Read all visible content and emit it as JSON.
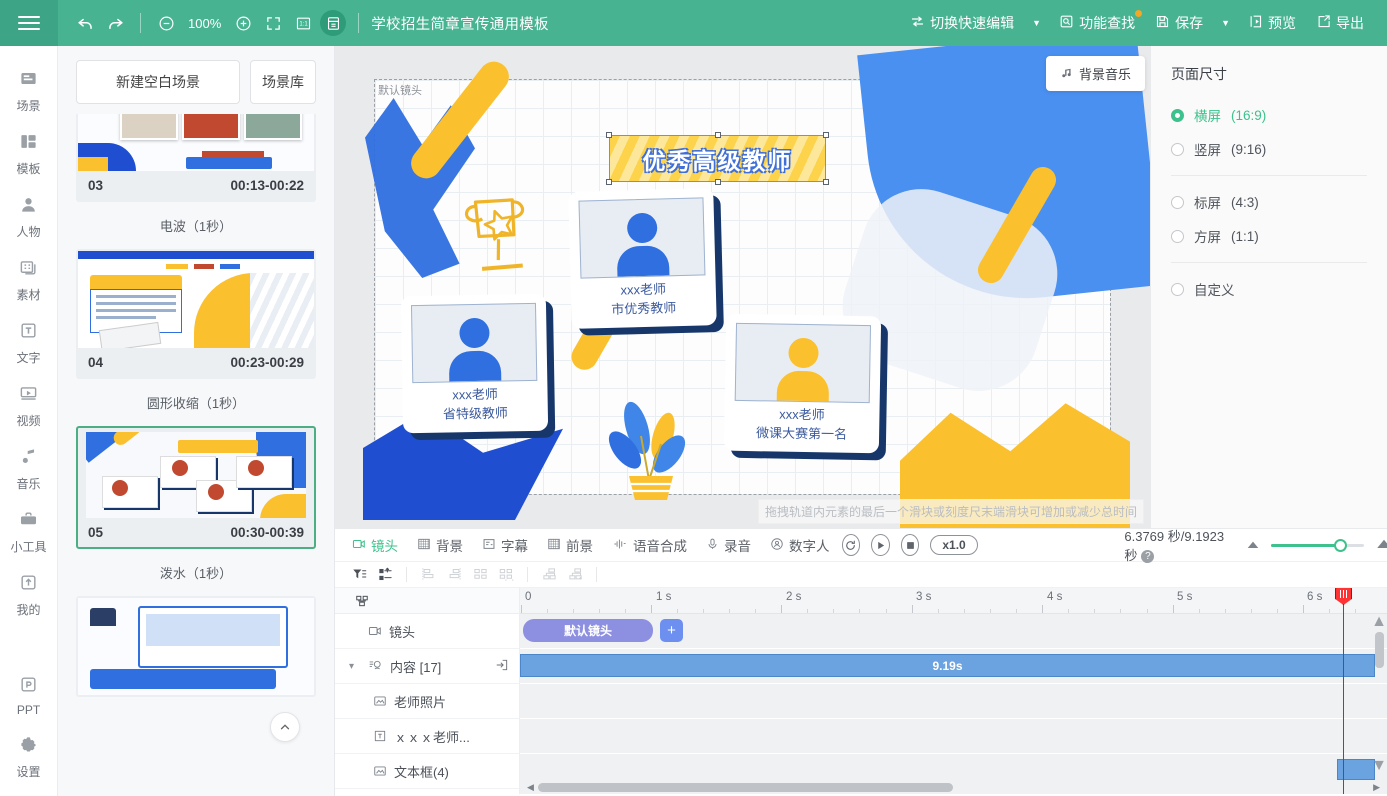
{
  "topbar": {
    "menu_icon": "hamburger-icon",
    "undo_icon": "undo-icon",
    "redo_icon": "redo-icon",
    "zoom_out_icon": "zoom-out-icon",
    "zoom_level": "100%",
    "zoom_in_icon": "zoom-in-icon",
    "fullscreen_icon": "fit-screen-icon",
    "actual_size_icon": "actual-size-icon",
    "safe_area_icon": "safe-area-icon",
    "doc_title": "学校招生简章宣传通用模板",
    "quick_edit": "切换快速编辑",
    "feature_search": "功能查找",
    "save": "保存",
    "preview": "预览",
    "export": "导出"
  },
  "rail": {
    "items": [
      {
        "label": "场景",
        "icon": "scene-icon"
      },
      {
        "label": "模板",
        "icon": "template-icon"
      },
      {
        "label": "人物",
        "icon": "person-icon"
      },
      {
        "label": "素材",
        "icon": "material-icon"
      },
      {
        "label": "文字",
        "icon": "text-icon"
      },
      {
        "label": "视频",
        "icon": "video-icon"
      },
      {
        "label": "音乐",
        "icon": "music-icon"
      },
      {
        "label": "小工具",
        "icon": "toolbox-icon"
      },
      {
        "label": "我的",
        "icon": "my-upload-icon"
      }
    ],
    "bottom": [
      {
        "label": "PPT",
        "icon": "ppt-icon"
      },
      {
        "label": "设置",
        "icon": "settings-icon"
      }
    ]
  },
  "scenes": {
    "new_blank": "新建空白场景",
    "library": "场景库",
    "cards": [
      {
        "index": "03",
        "time": "00:13-00:22",
        "selected": false,
        "transition": "电波（1秒）"
      },
      {
        "index": "04",
        "time": "00:23-00:29",
        "selected": false,
        "transition": "圆形收缩（1秒）"
      },
      {
        "index": "05",
        "time": "00:30-00:39",
        "selected": true,
        "transition": "泼水（1秒）"
      }
    ]
  },
  "canvas": {
    "camera_label": "默认镜头",
    "bgm_button": "背景音乐",
    "bgm_icon": "music-note-icon",
    "hint": "拖拽轨道内元素的最后一个滑块或刻度尺末端滑块可增加或减少总时间",
    "title_text": "优秀高级教师",
    "cards": [
      {
        "name": "xxx老师",
        "role": "市优秀教师",
        "color": "blue"
      },
      {
        "name": "xxx老师",
        "role": "省特级教师",
        "color": "blue"
      },
      {
        "name": "xxx老师",
        "role": "微课大赛第一名",
        "color": "yellow"
      }
    ]
  },
  "rightpanel": {
    "title": "页面尺寸",
    "options": [
      {
        "label": "横屏",
        "ratio": "(16:9)",
        "selected": true
      },
      {
        "label": "竖屏",
        "ratio": "(9:16)",
        "selected": false
      },
      {
        "label": "标屏",
        "ratio": "(4:3)",
        "selected": false
      },
      {
        "label": "方屏",
        "ratio": "(1:1)",
        "selected": false
      },
      {
        "label": "自定义",
        "ratio": "",
        "selected": false
      }
    ]
  },
  "timeline": {
    "tabs": [
      {
        "label": "镜头",
        "icon": "camera-icon",
        "active": true
      },
      {
        "label": "背景",
        "icon": "background-icon",
        "active": false
      },
      {
        "label": "字幕",
        "icon": "subtitle-icon",
        "active": false
      },
      {
        "label": "前景",
        "icon": "foreground-icon",
        "active": false
      },
      {
        "label": "语音合成",
        "icon": "tts-icon",
        "active": false
      },
      {
        "label": "录音",
        "icon": "microphone-icon",
        "active": false
      },
      {
        "label": "数字人",
        "icon": "digital-human-icon",
        "active": false
      }
    ],
    "replay_icon": "replay-icon",
    "play_icon": "play-icon",
    "stop_icon": "stop-icon",
    "speed": "x1.0",
    "time_display": "6.3769 秒/9.1923 秒",
    "help_icon": "help-icon",
    "zoom_min_icon": "zoom-track-out-icon",
    "zoom_max_icon": "zoom-track-in-icon",
    "collapse_icon": "double-chevron-down-icon",
    "tools": [
      {
        "icon": "filter-icon",
        "dim": false
      },
      {
        "icon": "track-order-icon",
        "dim": false
      },
      {
        "icon": "align-left-icon",
        "dim": true
      },
      {
        "icon": "align-right-icon",
        "dim": true
      },
      {
        "icon": "distribute-icon",
        "dim": true
      },
      {
        "icon": "distribute-even-icon",
        "dim": true
      },
      {
        "icon": "group-icon",
        "dim": true
      },
      {
        "icon": "ungroup-icon",
        "dim": true
      }
    ],
    "head_icon": "track-layers-icon",
    "ruler_ticks": [
      "0",
      "1 s",
      "2 s",
      "3 s",
      "4 s",
      "5 s",
      "6 s"
    ],
    "tracks": [
      {
        "name": "镜头",
        "icon": "camera-icon",
        "clip": "默认镜头",
        "add": "+",
        "indent": false,
        "caret": ""
      },
      {
        "name": "内容 [17]",
        "icon": "content-icon",
        "clip": "9.19s",
        "indent": false,
        "caret": "chevron-down-icon",
        "tail_icon": "enter-group-icon"
      },
      {
        "name": "老师照片",
        "icon": "image-icon",
        "clip": "",
        "indent": true,
        "caret": ""
      },
      {
        "name": "ｘｘｘ老师...",
        "icon": "text-box-icon",
        "clip": "",
        "indent": true,
        "caret": ""
      },
      {
        "name": "文本框(4)",
        "icon": "image-icon",
        "clip": "",
        "indent": true,
        "caret": ""
      }
    ]
  }
}
